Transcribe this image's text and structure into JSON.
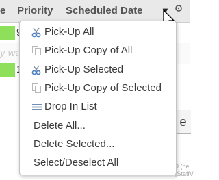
{
  "header": {
    "col_partial": "e",
    "col_priority": "Priority",
    "col_scheduled": "Scheduled Date",
    "sort_arrow": "▼",
    "gear_glyph": "⚙"
  },
  "rows": {
    "row1_suffix": "9",
    "row2_text": "y wa",
    "row3_suffix": "1"
  },
  "side": {
    "button_text": "e",
    "text_line1": "9 (be",
    "text_line2": "[StaffV"
  },
  "menu": {
    "items": [
      {
        "label": "Pick-Up All",
        "icon": "scissors-icon"
      },
      {
        "label": "Pick-Up Copy of All",
        "icon": "copy-icon"
      },
      {
        "label": "Pick-Up Selected",
        "icon": "scissors-icon"
      },
      {
        "label": "Pick-Up Copy of Selected",
        "icon": "copy-icon"
      },
      {
        "label": "Drop In List",
        "icon": "list-drop-icon"
      },
      {
        "label": "Delete All...",
        "icon": ""
      },
      {
        "label": "Delete Selected...",
        "icon": ""
      },
      {
        "label": "Select/Deselect All",
        "icon": ""
      }
    ]
  },
  "colors": {
    "menu_text": "#3a3a3a",
    "header_bg": "#e9e9e9",
    "row_green": "#8ee05b",
    "scissors_blue": "#4a7fc1"
  }
}
